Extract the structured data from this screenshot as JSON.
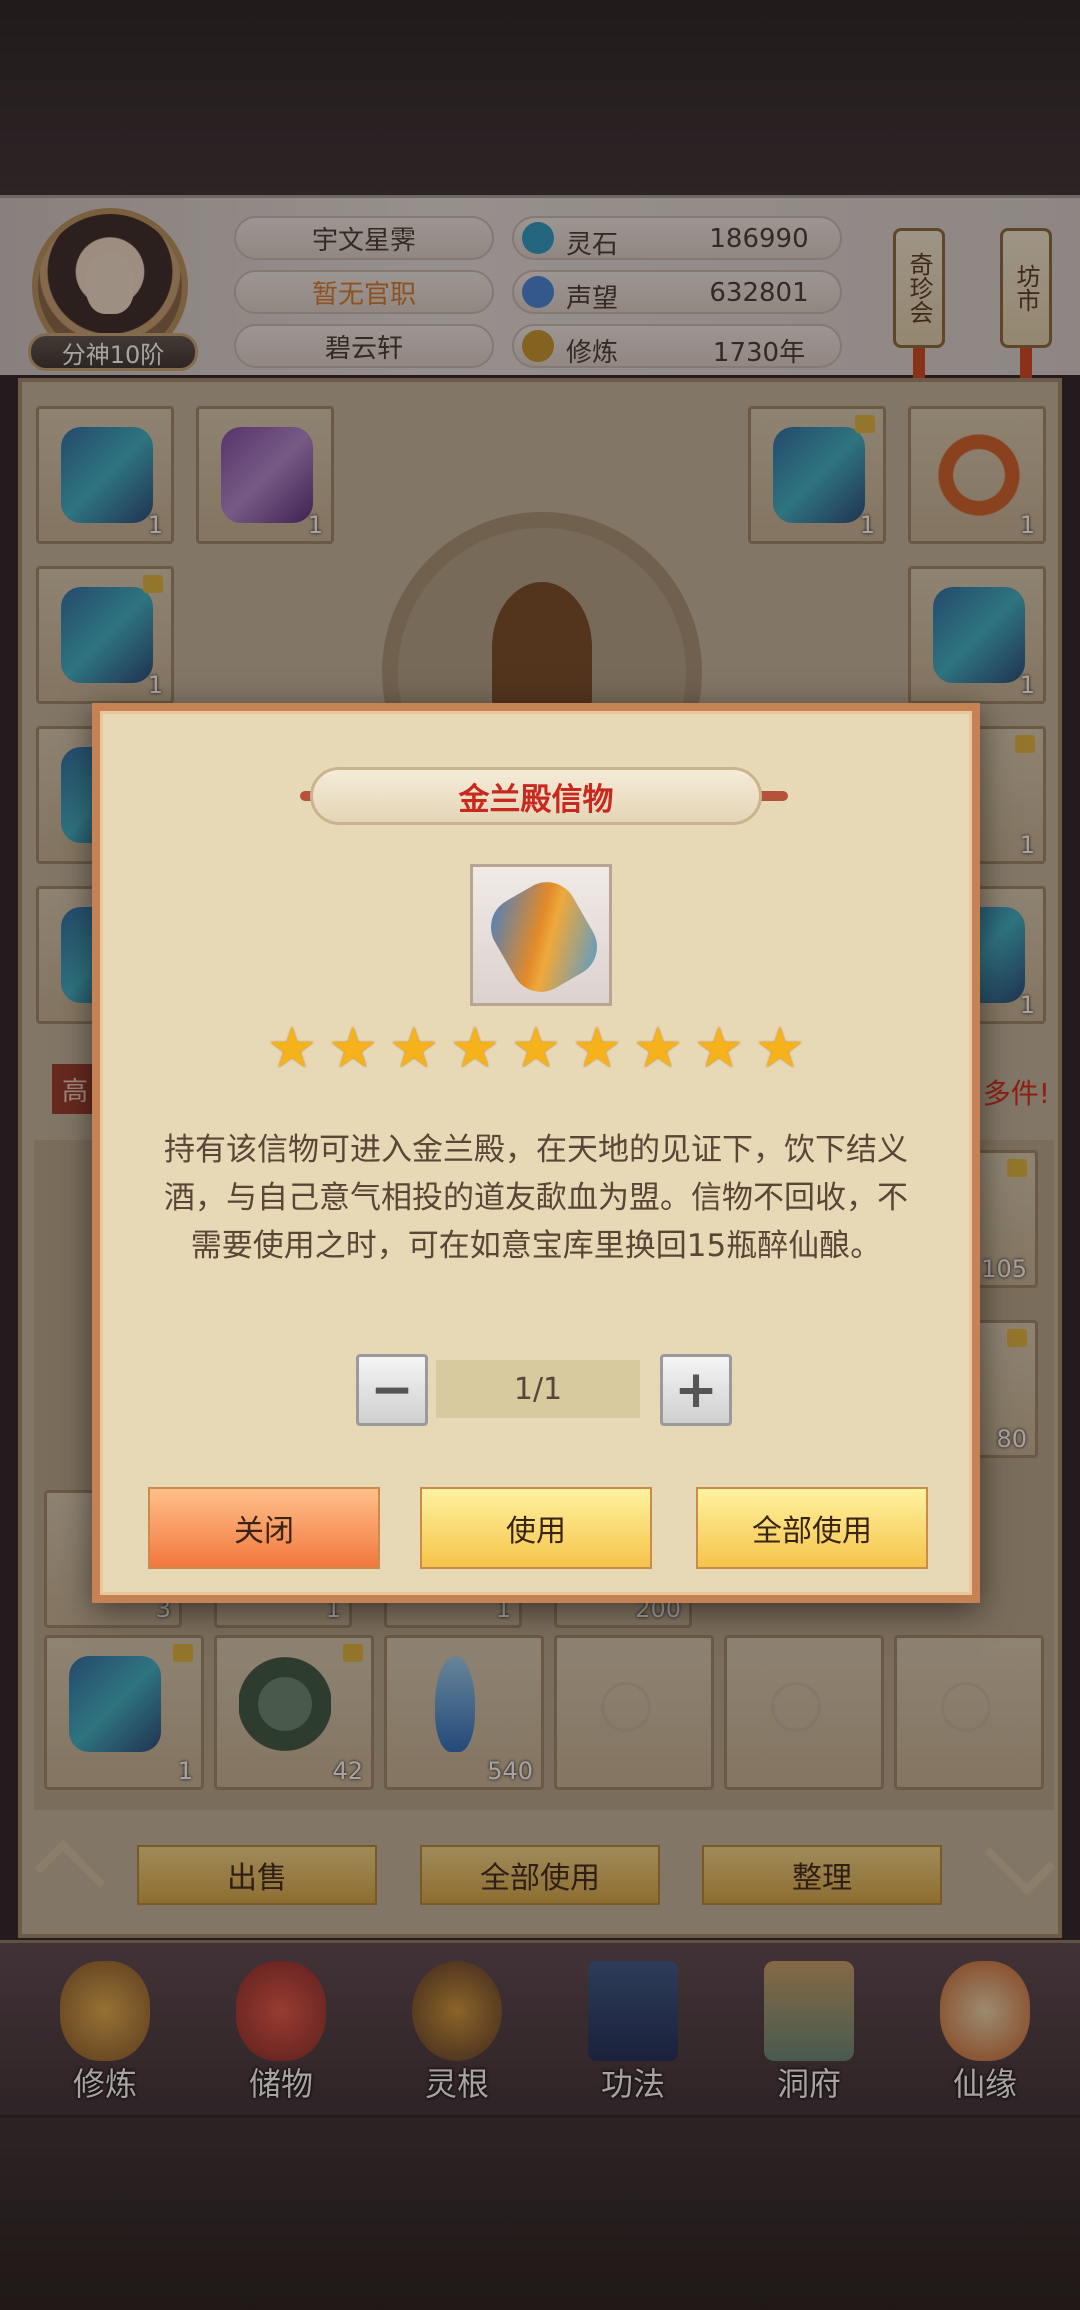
{
  "header": {
    "realm_badge": "分神10阶",
    "player_name": "宇文星霁",
    "official_title": "暂无官职",
    "sect": "碧云轩",
    "stats": [
      {
        "icon": "spirit-stone-icon",
        "label": "灵石",
        "value": "186990"
      },
      {
        "icon": "prestige-icon",
        "label": "声望",
        "value": "632801"
      },
      {
        "icon": "cultivation-icon",
        "label": "修炼",
        "value": "1730年"
      }
    ],
    "treasure_fair": "奇珍会",
    "market": "坊市"
  },
  "background": {
    "banner_partial": "高",
    "notice_partial": "多件!"
  },
  "equipment_slots": [
    {
      "item": "robe",
      "count": "1",
      "locked": false
    },
    {
      "item": "boots",
      "count": "1",
      "locked": false
    },
    {
      "item": "robe",
      "count": "1",
      "locked": true
    },
    {
      "item": "dragon-ring",
      "count": "1",
      "locked": false
    },
    {
      "item": "robe",
      "count": "1",
      "locked": true
    },
    {
      "item": "robe",
      "count": "1",
      "locked": false
    }
  ],
  "partial_counts": [
    "3",
    "1",
    "1",
    "200",
    "1",
    "1",
    "105",
    "80"
  ],
  "inventory_row": [
    {
      "item": "robe",
      "count": "1",
      "locked": true
    },
    {
      "item": "jade",
      "count": "42",
      "locked": true
    },
    {
      "item": "crystal",
      "count": "540",
      "locked": false
    },
    {
      "item": "empty",
      "count": "",
      "locked": false
    },
    {
      "item": "empty",
      "count": "",
      "locked": false
    },
    {
      "item": "empty",
      "count": "",
      "locked": false
    }
  ],
  "actions": {
    "sell": "出售",
    "use_all": "全部使用",
    "sort": "整理"
  },
  "nav": [
    {
      "label": "修炼",
      "icon": "meditation-icon"
    },
    {
      "label": "储物",
      "icon": "storage-bag-icon"
    },
    {
      "label": "灵根",
      "icon": "spirit-root-icon"
    },
    {
      "label": "功法",
      "icon": "book-icon"
    },
    {
      "label": "洞府",
      "icon": "cave-dwelling-icon"
    },
    {
      "label": "仙缘",
      "icon": "destiny-icon"
    }
  ],
  "dialog": {
    "title": "金兰殿信物",
    "item_icon": "scroll-token-icon",
    "star_count": 9,
    "description": "持有该信物可进入金兰殿，在天地的见证下，饮下结义酒，与自己意气相投的道友歃血为盟。信物不回收，不需要使用之时，可在如意宝库里换回15瓶醉仙酿。",
    "quantity": "1/1",
    "minus": "−",
    "plus": "+",
    "close": "关闭",
    "use": "使用",
    "use_all": "全部使用"
  },
  "colors": {
    "dialog_title": "#c9281f",
    "dialog_border": "#c58355",
    "star": "#f6b21b",
    "official_title": "#d87b2e"
  }
}
